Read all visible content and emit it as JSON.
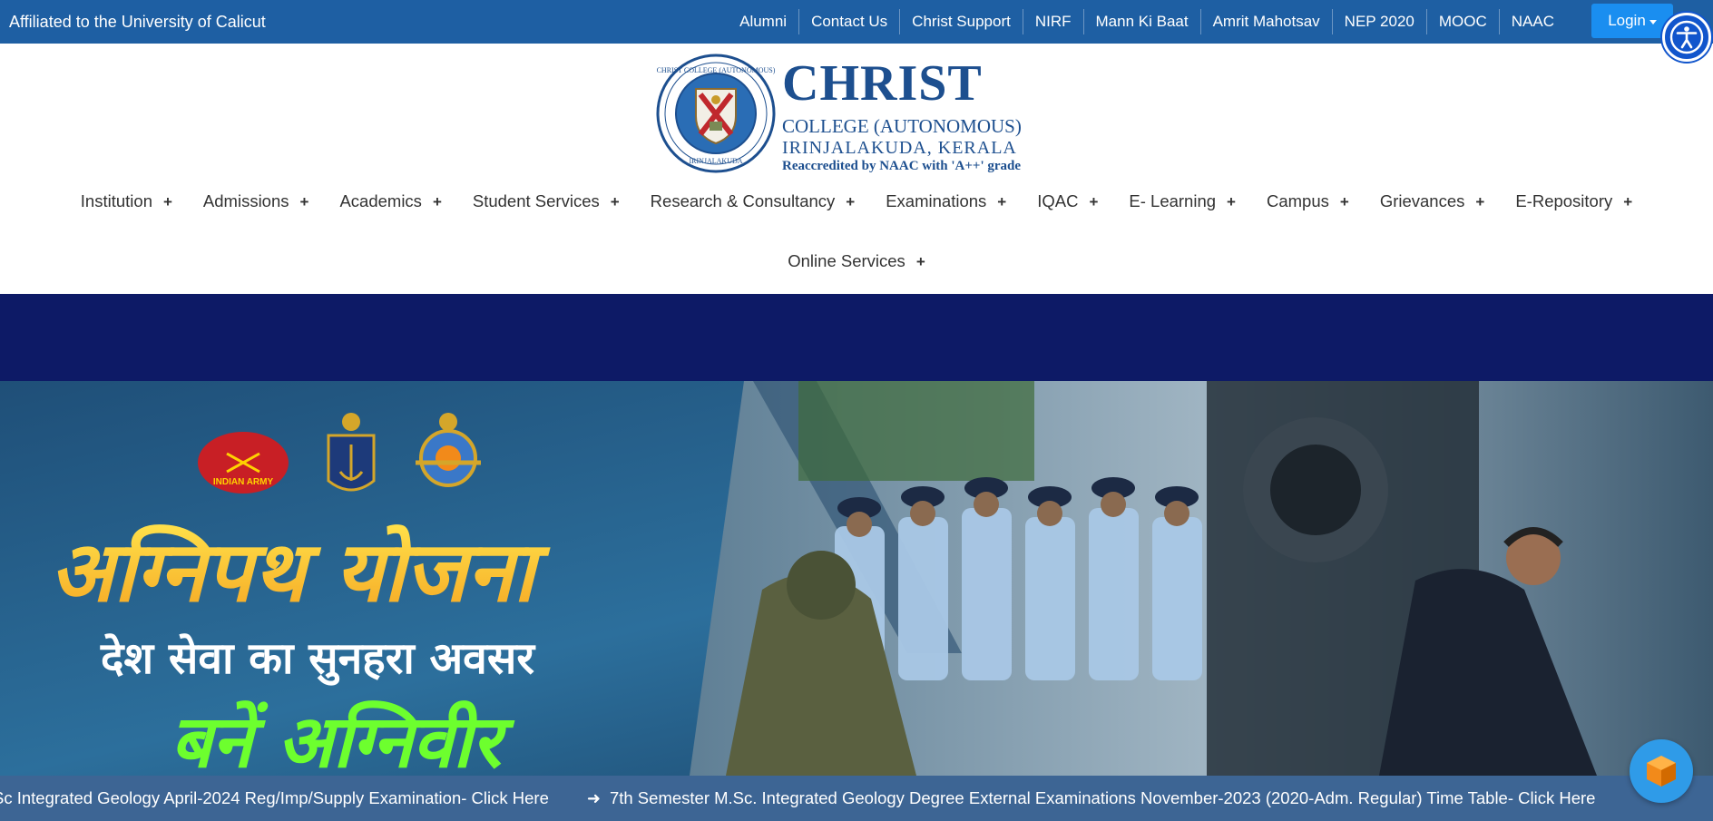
{
  "topbar": {
    "affiliation": "Affiliated to the University of Calicut",
    "links": [
      "Alumni",
      "Contact Us",
      "Christ Support",
      "NIRF",
      "Mann Ki Baat",
      "Amrit Mahotsav",
      "NEP 2020",
      "MOOC",
      "NAAC"
    ],
    "login_label": "Login",
    "accessibility_icon": "accessibility-icon"
  },
  "brand": {
    "name": "CHRIST",
    "line1": "COLLEGE (AUTONOMOUS)",
    "line2": "IRINJALAKUDA, KERALA",
    "line3": "Reaccredited by NAAC with 'A++' grade",
    "seal_text_top": "CHRIST COLLEGE (AUTONOMOUS)",
    "seal_text_bottom": "IRINJALAKUDA"
  },
  "nav": {
    "row1": [
      "Institution",
      "Admissions",
      "Academics",
      "Student Services",
      "Research & Consultancy",
      "Examinations",
      "IQAC",
      "E- Learning",
      "Campus",
      "Grievances",
      "E-Repository"
    ],
    "row2": [
      "Online Services"
    ],
    "expand_symbol": "+"
  },
  "banner": {
    "headline": "अग्निपथ योजना",
    "subline": "देश सेवा का सुनहरा अवसर",
    "tagline": "बनें अग्निवीर",
    "emblem_army": "INDIAN ARMY"
  },
  "ticker": {
    "items": [
      "Sc Integrated Geology April-2024 Reg/Imp/Supply Examination- Click Here",
      "7th Semester M.Sc. Integrated Geology Degree External Examinations November-2023 (2020-Adm. Regular) Time Table- Click Here"
    ],
    "arrow_icon": "arrow-right-icon"
  },
  "colors": {
    "topbar": "#1e5fa3",
    "brand": "#1d4f8f",
    "band": "#0d1a66",
    "ticker": "#3d6594",
    "login": "#1a8ef0"
  },
  "chat_widget_icon": "chat-cube-icon"
}
